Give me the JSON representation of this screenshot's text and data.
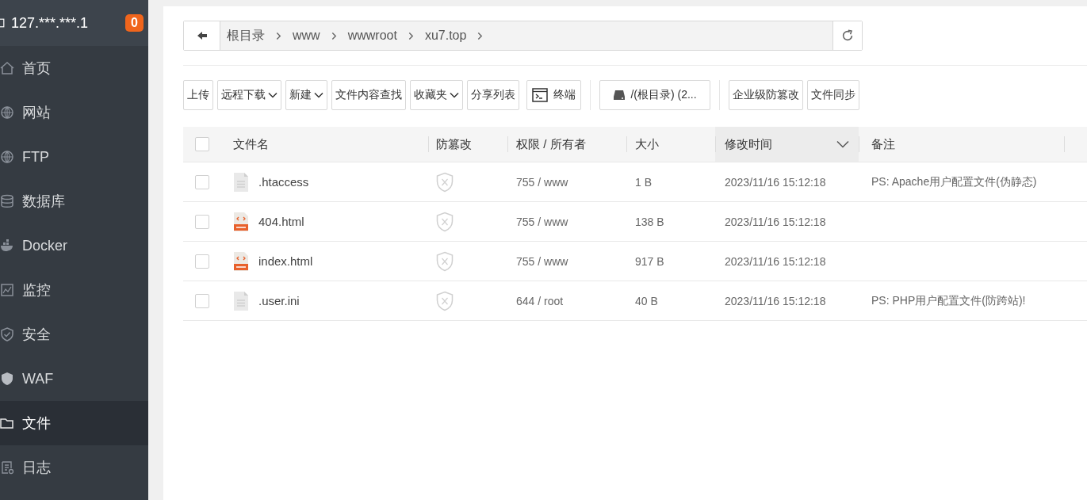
{
  "sidebar": {
    "server": "127.***.***.1",
    "badge": "0",
    "items": [
      {
        "label": "首页",
        "selected": false
      },
      {
        "label": "网站",
        "selected": false
      },
      {
        "label": "FTP",
        "selected": false
      },
      {
        "label": "数据库",
        "selected": false
      },
      {
        "label": "Docker",
        "selected": false
      },
      {
        "label": "监控",
        "selected": false
      },
      {
        "label": "安全",
        "selected": false
      },
      {
        "label": "WAF",
        "selected": false
      },
      {
        "label": "文件",
        "selected": true
      },
      {
        "label": "日志",
        "selected": false
      }
    ]
  },
  "path": {
    "segments": [
      "根目录",
      "www",
      "wwwroot",
      "xu7.top"
    ]
  },
  "toolbar": [
    [
      {
        "label": "上传",
        "kind": "plain"
      },
      {
        "label": "远程下载",
        "kind": "dropdown"
      },
      {
        "label": "新建",
        "kind": "dropdown"
      },
      {
        "label": "文件内容查找",
        "kind": "plain"
      },
      {
        "label": "收藏夹",
        "kind": "dropdown"
      },
      {
        "label": "分享列表",
        "kind": "plain"
      },
      {
        "label": "终端",
        "kind": "terminal"
      }
    ],
    [
      {
        "label": "/(根目录) (2...",
        "kind": "disk"
      }
    ],
    [
      {
        "label": "企业级防篡改",
        "kind": "plain"
      },
      {
        "label": "文件同步",
        "kind": "plain"
      }
    ]
  ],
  "table": {
    "select_all": {
      "checked": false
    },
    "columns": [
      {
        "label": "文件名",
        "sorted": false
      },
      {
        "label": "防篡改",
        "sorted": false
      },
      {
        "label": "权限 / 所有者",
        "sorted": false
      },
      {
        "label": "大小",
        "sorted": false
      },
      {
        "label": "修改时间",
        "sorted": true
      },
      {
        "label": "备注",
        "sorted": false
      }
    ],
    "rows": [
      {
        "checked": false,
        "kind": "doc",
        "name": ".htaccess",
        "permission": "755 / www",
        "size": "1 B",
        "modified": "2023/11/16 15:12:18",
        "note": "PS: Apache用户配置文件(伪静态)"
      },
      {
        "checked": false,
        "kind": "web",
        "name": "404.html",
        "permission": "755 / www",
        "size": "138 B",
        "modified": "2023/11/16 15:12:18"
      },
      {
        "checked": false,
        "kind": "web",
        "name": "index.html",
        "permission": "755 / www",
        "size": "917 B",
        "modified": "2023/11/16 15:12:18"
      },
      {
        "checked": false,
        "kind": "doc",
        "name": ".user.ini",
        "permission": "644 / root",
        "size": "40 B",
        "modified": "2023/11/16 15:12:18",
        "note": "PS: PHP用户配置文件(防跨站)!"
      }
    ]
  }
}
